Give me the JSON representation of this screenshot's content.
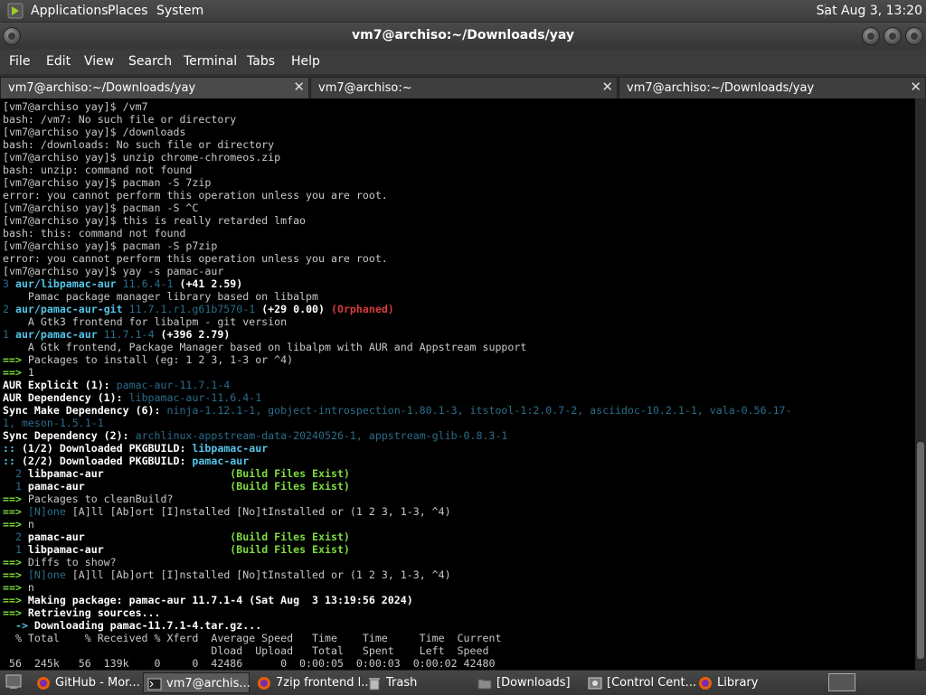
{
  "top_panel": {
    "menus": [
      "Applications",
      "Places",
      "System"
    ],
    "clock": "Sat Aug 3, 13:20"
  },
  "window": {
    "title": "vm7@archiso:~/Downloads/yay"
  },
  "menubar": [
    "File",
    "Edit",
    "View",
    "Search",
    "Terminal",
    "Tabs",
    "Help"
  ],
  "tabs": [
    {
      "label": "vm7@archiso:~/Downloads/yay",
      "active": true
    },
    {
      "label": "vm7@archiso:~",
      "active": false
    },
    {
      "label": "vm7@archiso:~/Downloads/yay",
      "active": false
    }
  ],
  "terminal": {
    "lines": [
      [
        {
          "t": "[vm7@archiso yay]$ /vm7"
        }
      ],
      [
        {
          "t": "bash: /vm7: No such file or directory"
        }
      ],
      [
        {
          "t": "[vm7@archiso yay]$ /downloads"
        }
      ],
      [
        {
          "t": "bash: /downloads: No such file or directory"
        }
      ],
      [
        {
          "t": "[vm7@archiso yay]$ unzip chrome-chromeos.zip"
        }
      ],
      [
        {
          "t": "bash: unzip: command not found"
        }
      ],
      [
        {
          "t": "[vm7@archiso yay]$ pacman -S 7zip"
        }
      ],
      [
        {
          "t": "error: you cannot perform this operation unless you are root."
        }
      ],
      [
        {
          "t": "[vm7@archiso yay]$ pacman -S ^C"
        }
      ],
      [
        {
          "t": "[vm7@archiso yay]$ this is really retarded lmfao"
        }
      ],
      [
        {
          "t": "bash: this: command not found"
        }
      ],
      [
        {
          "t": "[vm7@archiso yay]$ pacman -S p7zip"
        }
      ],
      [
        {
          "t": "error: you cannot perform this operation unless you are root."
        }
      ],
      [
        {
          "t": "[vm7@archiso yay]$ yay -s pamac-aur"
        }
      ],
      [
        {
          "t": "3 ",
          "c": "num"
        },
        {
          "t": "aur/libpamac-aur ",
          "c": "bl"
        },
        {
          "t": "11.6.4-1 ",
          "c": "dim"
        },
        {
          "t": "(+41 2.59)",
          "c": "b"
        }
      ],
      [
        {
          "t": "    Pamac package manager library based on libalpm"
        }
      ],
      [
        {
          "t": "2 ",
          "c": "num"
        },
        {
          "t": "aur/pamac-aur-git ",
          "c": "bl"
        },
        {
          "t": "11.7.1.r1.g61b7570-1 ",
          "c": "dim"
        },
        {
          "t": "(+29 0.00) ",
          "c": "b"
        },
        {
          "t": "(Orphaned)",
          "c": "red"
        }
      ],
      [
        {
          "t": "    A Gtk3 frontend for libalpm - git version"
        }
      ],
      [
        {
          "t": "1 ",
          "c": "num"
        },
        {
          "t": "aur/pamac-aur ",
          "c": "bl"
        },
        {
          "t": "11.7.1-4 ",
          "c": "dim"
        },
        {
          "t": "(+396 2.79)",
          "c": "b"
        }
      ],
      [
        {
          "t": "    A Gtk frontend, Package Manager based on libalpm with AUR and Appstream support"
        }
      ],
      [
        {
          "t": "==> ",
          "c": "gp"
        },
        {
          "t": "Packages to install (eg: 1 2 3, 1-3 or ^4)"
        }
      ],
      [
        {
          "t": "==> ",
          "c": "gp"
        },
        {
          "t": "1"
        }
      ],
      [
        {
          "t": "AUR Explicit (1): ",
          "c": "b"
        },
        {
          "t": "pamac-aur-11.7.1-4",
          "c": "dim"
        }
      ],
      [
        {
          "t": "AUR Dependency (1): ",
          "c": "b"
        },
        {
          "t": "libpamac-aur-11.6.4-1",
          "c": "dim"
        }
      ],
      [
        {
          "t": "Sync Make Dependency (6): ",
          "c": "b"
        },
        {
          "t": "ninja-1.12.1-1, gobject-introspection-1.80.1-3, itstool-1:2.0.7-2, asciidoc-10.2.1-1, vala-0.56.17-",
          "c": "dim"
        }
      ],
      [
        {
          "t": "1, meson-1.5.1-1",
          "c": "dim"
        }
      ],
      [
        {
          "t": "Sync Dependency (2): ",
          "c": "b"
        },
        {
          "t": "archlinux-appstream-data-20240526-1, appstream-glib-0.8.3-1",
          "c": "dim"
        }
      ],
      [
        {
          "t": ":: ",
          "c": "bl"
        },
        {
          "t": "(1/2) Downloaded PKGBUILD: ",
          "c": "b"
        },
        {
          "t": "libpamac-aur",
          "c": "bl"
        }
      ],
      [
        {
          "t": ":: ",
          "c": "bl"
        },
        {
          "t": "(2/2) Downloaded PKGBUILD: ",
          "c": "b"
        },
        {
          "t": "pamac-aur",
          "c": "bl"
        }
      ],
      [
        {
          "t": "  2 ",
          "c": "num"
        },
        {
          "t": "libpamac-aur                    ",
          "c": "b"
        },
        {
          "t": "(Build Files Exist)",
          "c": "g"
        }
      ],
      [
        {
          "t": "  1 ",
          "c": "num"
        },
        {
          "t": "pamac-aur                       ",
          "c": "b"
        },
        {
          "t": "(Build Files Exist)",
          "c": "g"
        }
      ],
      [
        {
          "t": "==> ",
          "c": "gp"
        },
        {
          "t": "Packages to cleanBuild?"
        }
      ],
      [
        {
          "t": "==> ",
          "c": "gp"
        },
        {
          "t": "[N]one ",
          "c": "dim"
        },
        {
          "t": "[A]ll [Ab]ort [I]nstalled [No]tInstalled or (1 2 3, 1-3, ^4)"
        }
      ],
      [
        {
          "t": "==> ",
          "c": "gp"
        },
        {
          "t": "n"
        }
      ],
      [
        {
          "t": "  2 ",
          "c": "num"
        },
        {
          "t": "pamac-aur                       ",
          "c": "b"
        },
        {
          "t": "(Build Files Exist)",
          "c": "g"
        }
      ],
      [
        {
          "t": "  1 ",
          "c": "num"
        },
        {
          "t": "libpamac-aur                    ",
          "c": "b"
        },
        {
          "t": "(Build Files Exist)",
          "c": "g"
        }
      ],
      [
        {
          "t": "==> ",
          "c": "gp"
        },
        {
          "t": "Diffs to show?"
        }
      ],
      [
        {
          "t": "==> ",
          "c": "gp"
        },
        {
          "t": "[N]one ",
          "c": "dim"
        },
        {
          "t": "[A]ll [Ab]ort [I]nstalled [No]tInstalled or (1 2 3, 1-3, ^4)"
        }
      ],
      [
        {
          "t": "==> ",
          "c": "gp"
        },
        {
          "t": "n"
        }
      ],
      [
        {
          "t": "==> ",
          "c": "gp"
        },
        {
          "t": "Making package: pamac-aur 11.7.1-4 (Sat Aug  3 13:19:56 2024)",
          "c": "b"
        }
      ],
      [
        {
          "t": "==> ",
          "c": "gp"
        },
        {
          "t": "Retrieving sources...",
          "c": "b"
        }
      ],
      [
        {
          "t": "  -> ",
          "c": "bl"
        },
        {
          "t": "Downloading pamac-11.7.1-4.tar.gz...",
          "c": "b"
        }
      ],
      [
        {
          "t": "  % Total    % Received % Xferd  Average Speed   Time    Time     Time  Current"
        }
      ],
      [
        {
          "t": "                                 Dload  Upload   Total   Spent    Left  Speed"
        }
      ],
      [
        {
          "t": " 56  245k   56  139k    0     0  42486      0  0:00:05  0:00:03  0:00:02 42480"
        }
      ]
    ]
  },
  "taskbar": {
    "tasks": [
      {
        "label": "GitHub - Mor...",
        "icon": "firefox-icon",
        "active": false
      },
      {
        "label": "vm7@archis...",
        "icon": "terminal-icon",
        "active": true
      },
      {
        "label": "7zip frontend l...",
        "icon": "firefox-icon",
        "active": false
      },
      {
        "label": "Trash",
        "icon": "trash-icon",
        "active": false
      },
      {
        "label": "[Downloads]",
        "icon": "folder-icon",
        "active": false
      },
      {
        "label": "[Control Cent...",
        "icon": "control-center-icon",
        "active": false
      },
      {
        "label": "Library",
        "icon": "firefox-icon",
        "active": false
      }
    ]
  },
  "colors": {
    "terminal_bg": "#000000",
    "terminal_fg": "#c8c8c8",
    "green": "#7ddc3f",
    "blue": "#55c4e8",
    "red": "#d93b3b",
    "dim_blue": "#2a6c8a"
  }
}
